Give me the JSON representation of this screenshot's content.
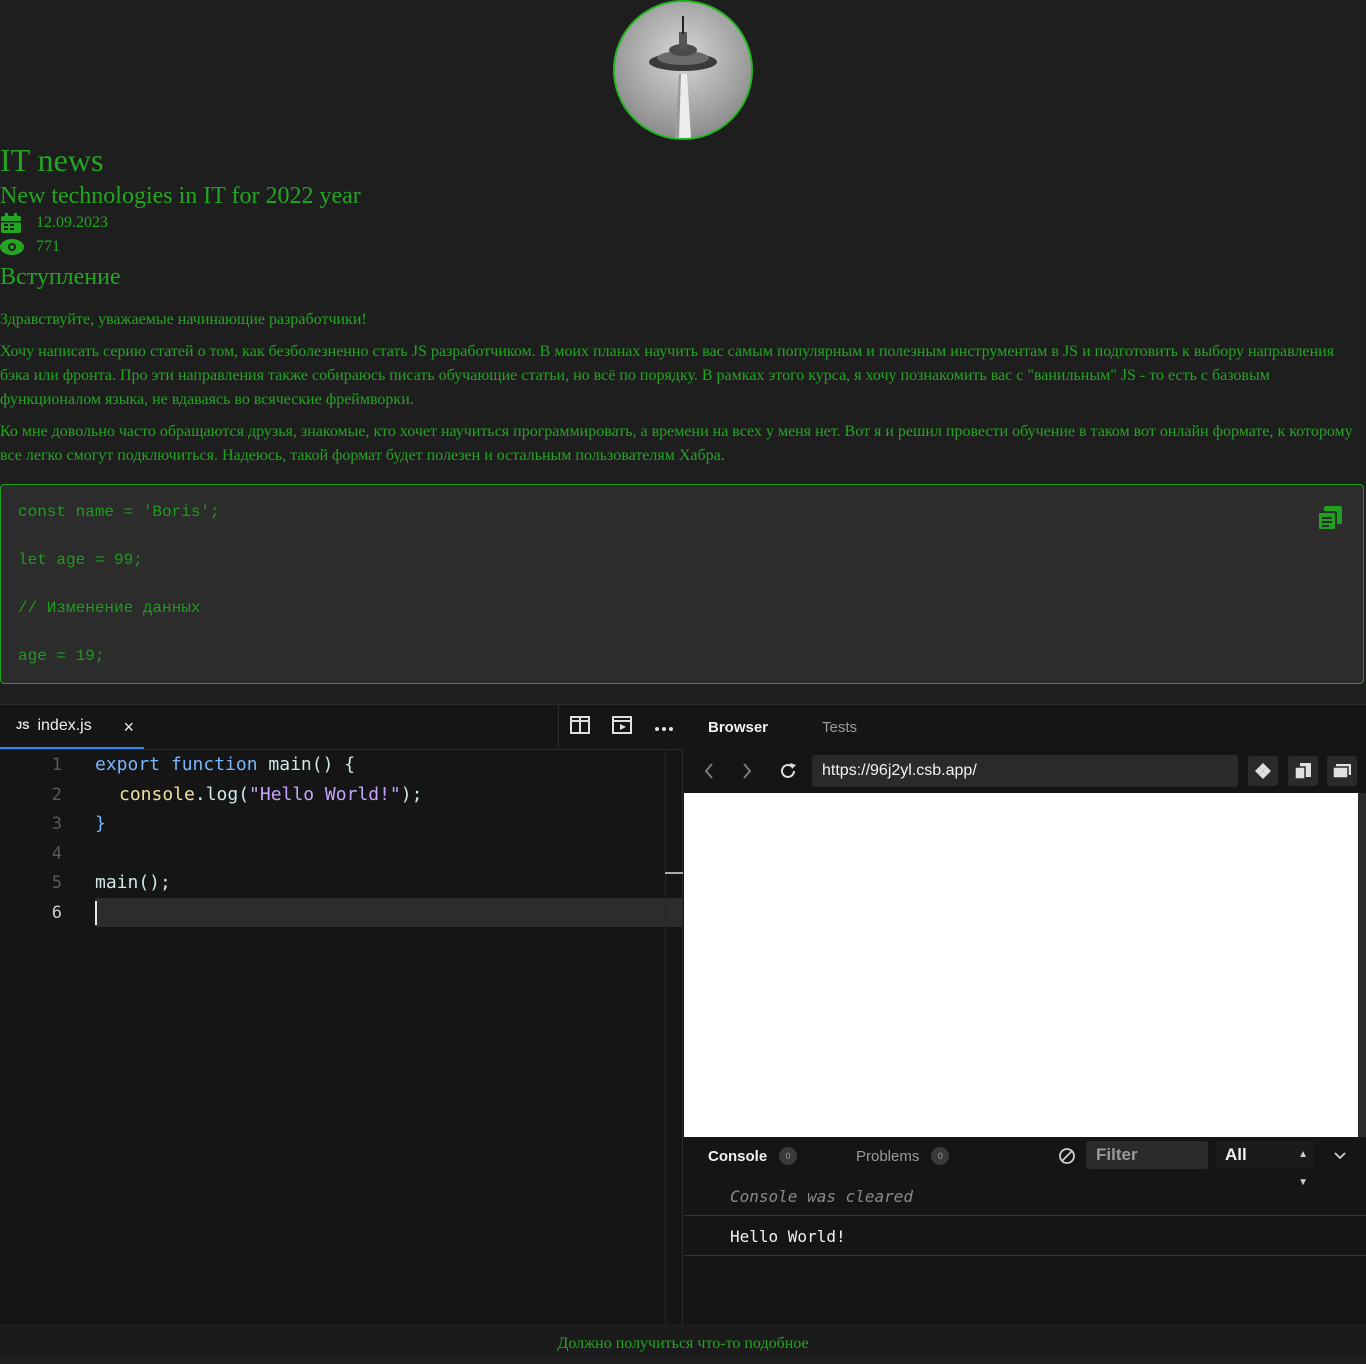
{
  "site": {
    "title": "IT news"
  },
  "article": {
    "title": "New technologies in IT for 2022 year",
    "date": "12.09.2023",
    "views": "771",
    "section": "Вступление",
    "paragraphs": [
      "Здравствуйте, уважаемые начинающие разработчики!",
      "Хочу написать серию статей о том, как безболезненно стать JS разработчиком. В моих планах научить вас самым популярным и полезным инструментам в JS и подготовить к выбору направления бэка или фронта. Про эти направления также собираюсь писать обучающие статьи, но всё по порядку. В рамках этого курса, я хочу познакомить вас с \"ванильным\" JS - то есть с базовым функционалом языка, не вдаваясь во всяческие фреймворки.",
      "Ко мне довольно часто обращаются друзья, знакомые, кто хочет научиться программировать, а времени на всех у меня нет. Вот я и решил провести обучение в таком вот онлайн формате, к которому все легко смогут подключиться. Надеюсь, такой формат будет полезен и остальным пользователям Хабра."
    ],
    "code_lines": [
      "const name = 'Boris';",
      "let age = 99;",
      "// Изменение данных",
      "age = 19;"
    ]
  },
  "editor": {
    "file_badge": "JS",
    "file_name": "index.js",
    "close": "×",
    "line_numbers": [
      "1",
      "2",
      "3",
      "4",
      "5",
      "6"
    ],
    "code": {
      "l1_kw1": "export",
      "l1_kw2": "function",
      "l1_rest": "main() {",
      "l2_a": "console",
      "l2_b": ".log(",
      "l2_str": "\"Hello World!\"",
      "l2_c": ");",
      "l3": "}",
      "l5": "main();"
    }
  },
  "browser": {
    "tabs": [
      "Browser",
      "Tests"
    ],
    "url": "https://96j2yl.csb.app/",
    "console_tabs": [
      {
        "label": "Console",
        "count": "0"
      },
      {
        "label": "Problems",
        "count": "0"
      }
    ],
    "filter_placeholder": "Filter",
    "level": "All",
    "logs": [
      "Console was cleared",
      "Hello World!"
    ]
  },
  "caption": "Должно получиться что-то подобное",
  "colors": {
    "accent": "#22a622",
    "background": "#1e1e1e",
    "code_bg": "#2c2c2c",
    "tab_underline": "#3b82f6"
  }
}
